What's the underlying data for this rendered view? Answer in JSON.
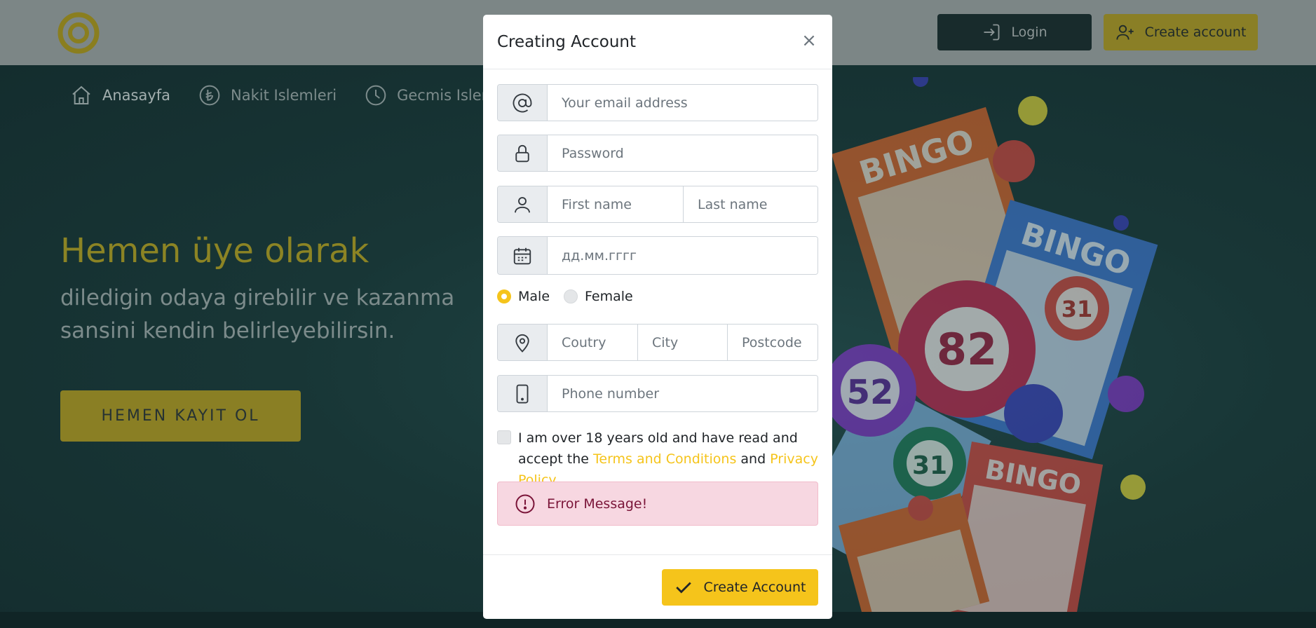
{
  "header": {
    "login_label": "Login",
    "create_account_label": "Create account"
  },
  "nav": {
    "items": [
      {
        "label": "Anasayfa",
        "icon": "home-icon"
      },
      {
        "label": "Nakit Islemleri",
        "icon": "lira-coin-icon"
      },
      {
        "label": "Gecmis Islemle",
        "icon": "clock-icon"
      }
    ]
  },
  "hero": {
    "title": "Hemen üye olarak",
    "subtitle": "diledigin odaya girebilir ve kazanma sansini kendin belirleyebilirsin.",
    "cta_label": "HEMEN KAYIT OL"
  },
  "modal": {
    "title": "Creating Account",
    "close_symbol": "×",
    "fields": {
      "email_placeholder": "Your email address",
      "password_placeholder": "Password",
      "first_name_placeholder": "First name",
      "last_name_placeholder": "Last name",
      "date_placeholder": "дд.мм.гггг",
      "country_placeholder": "Coutry",
      "city_placeholder": "City",
      "postcode_placeholder": "Postcode",
      "phone_placeholder": "Phone number"
    },
    "gender": {
      "male_label": "Male",
      "female_label": "Female",
      "selected": "Male"
    },
    "terms": {
      "text_before": "I am over 18 years old and have read and accept the ",
      "terms_link": "Terms and Conditions",
      "and": " and ",
      "privacy_link": "Privacy Policy",
      "checked": false
    },
    "error_message": "Error Message!",
    "submit_label": "Create Account"
  },
  "colors": {
    "accent": "#f5c41b",
    "error_bg": "#f7d7e1",
    "error_text": "#7a1438",
    "hero_bg": "#173535"
  },
  "bingo_art": {
    "numbers": [
      "82",
      "52",
      "31",
      "31"
    ],
    "card_word": "BINGO"
  }
}
